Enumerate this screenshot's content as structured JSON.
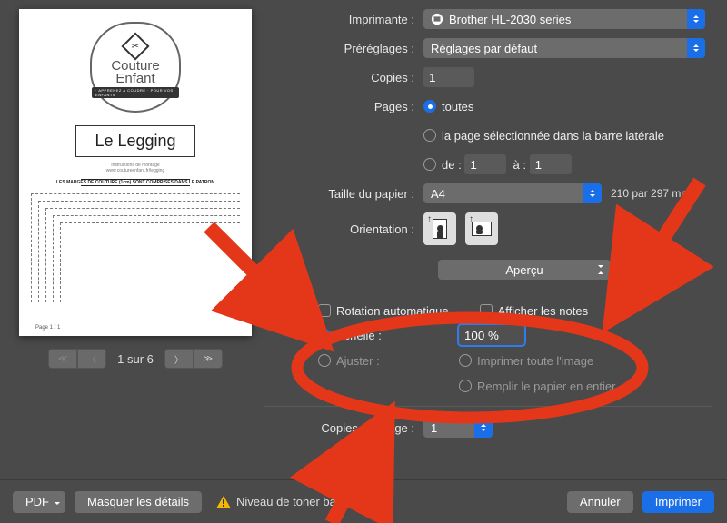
{
  "labels": {
    "printer": "Imprimante :",
    "presets": "Préréglages :",
    "copies": "Copies :",
    "pages": "Pages :",
    "pages_all": "toutes",
    "pages_selected": "la page sélectionnée dans la barre latérale",
    "pages_from": "de :",
    "pages_to": "à :",
    "paper_size": "Taille du papier :",
    "orientation": "Orientation :",
    "section": "Aperçu",
    "auto_rotate": "Rotation automatique",
    "show_notes": "Afficher les notes",
    "scale": "Échelle :",
    "fit": "Ajuster :",
    "print_full": "Imprimer toute l'image",
    "fill_paper": "Remplir le papier en entier",
    "copies_per_page": "Copies par page :"
  },
  "values": {
    "printer": "Brother HL-2030 series",
    "presets": "Réglages par défaut",
    "copies": "1",
    "from": "1",
    "to": "1",
    "paper": "A4",
    "paper_dim": "210 par 297 mm",
    "scale": "100 %",
    "copies_per_page": "1"
  },
  "preview": {
    "brand1": "Couture",
    "brand2": "Enfant",
    "brand_tag": "· APPRENEZ À COUDRE · POUR VOS ENFANTS",
    "title": "Le Legging",
    "sub1": "Instructions de montage",
    "sub2": "www.coutureenfant.fr/legging",
    "margin": "LES MARGES DE COUTURE (1cm) SONT COMPRISES DANS LE PATRON",
    "pgnum": "Page 1 / 1",
    "pager": "1 sur 6"
  },
  "footer": {
    "pdf": "PDF",
    "hide": "Masquer les détails",
    "status": "Niveau de toner bas",
    "cancel": "Annuler",
    "print": "Imprimer"
  }
}
